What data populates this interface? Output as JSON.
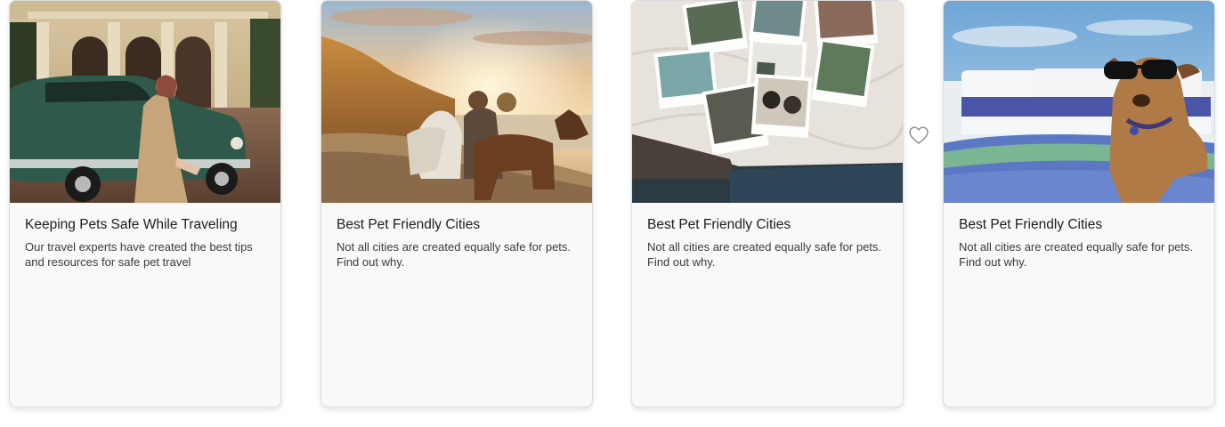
{
  "cards": [
    {
      "title": "Keeping Pets Safe While Traveling",
      "description": "Our travel experts have created the best tips and resources for safe pet travel",
      "image": "vintage-car-photo"
    },
    {
      "title": "Best Pet Friendly Cities",
      "description": "Not all cities are created equally safe for pets. Find out why.",
      "image": "sunset-dogs-photo"
    },
    {
      "title": "Best Pet Friendly Cities",
      "description": "Not all cities are created equally safe for pets. Find out why.",
      "image": "polaroid-photos-photo"
    },
    {
      "title": "Best Pet Friendly Cities",
      "description": "Not all cities are created equally safe for pets. Find out why.",
      "image": "dog-sunglasses-boat-photo"
    }
  ],
  "favorite_icon": "heart-outline-icon",
  "colors": {
    "card_background": "#faf9f8",
    "card_border": "#dcdcdc",
    "title_text": "#1d1d1d",
    "body_text": "#3a3a3a",
    "heart_stroke": "#8a8a8a"
  }
}
